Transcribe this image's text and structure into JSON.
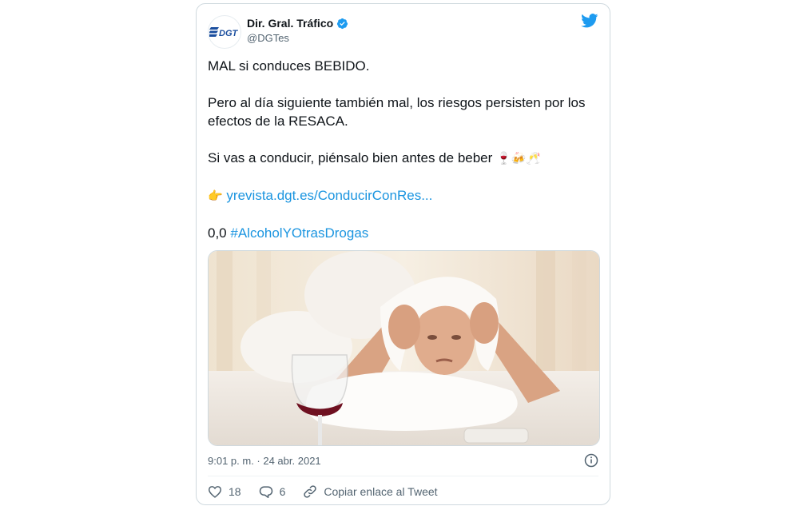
{
  "author": {
    "name": "Dir. Gral. Tráfico",
    "handle": "@DGTes",
    "logo_text": "DGT",
    "verified_icon": "verified-badge-icon"
  },
  "tweet": {
    "line1": "MAL si conduces BEBIDO.",
    "line2": "Pero al día siguiente también mal, los riesgos persisten por los efectos de la RESACA.",
    "line3": "Si vas a conducir, piénsalo bien antes de beber",
    "line3_emoji": "🍷🍻🥂",
    "link_emoji": "👉",
    "link": "yrevista.dgt.es/ConducirConRes...",
    "hashtag_prefix": "0,0",
    "hashtag": "#AlcoholYOtrasDrogas"
  },
  "media": {
    "icon": "photo-man-with-hangover"
  },
  "meta": {
    "timestamp": "9:01 p. m. · 24 abr. 2021"
  },
  "actions": {
    "likes": "18",
    "replies": "6",
    "copy_link": "Copiar enlace al Tweet"
  },
  "colors": {
    "accent": "#1d9bf0",
    "link": "#1b95e0",
    "text": "#0f1419",
    "secondary": "#536471"
  }
}
